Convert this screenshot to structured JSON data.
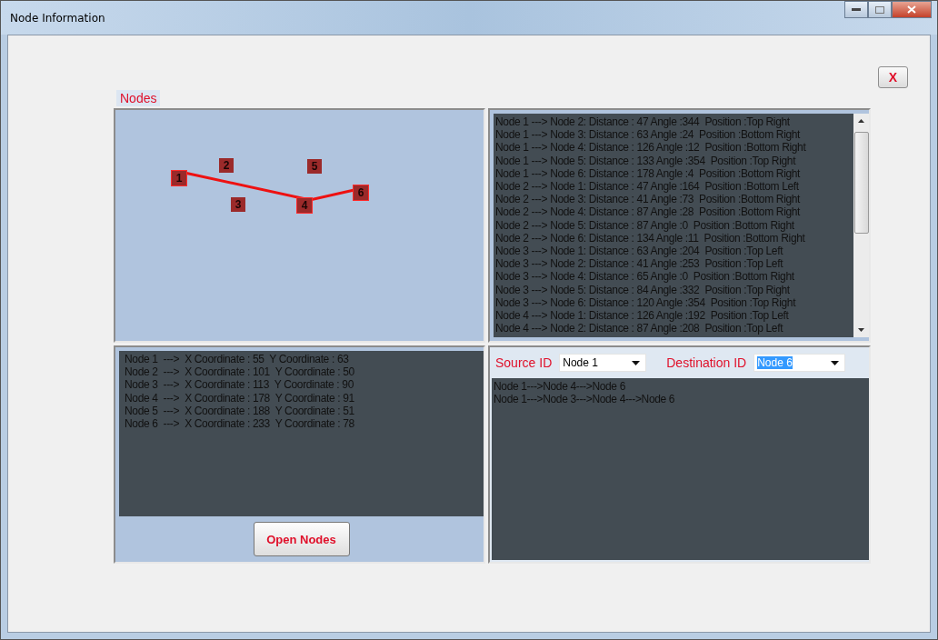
{
  "window": {
    "title": "Node Information"
  },
  "close_form_button": {
    "label": "X"
  },
  "nodes_panel": {
    "label": "Nodes",
    "nodes": [
      {
        "label": "1",
        "on_path": true
      },
      {
        "label": "2",
        "on_path": false
      },
      {
        "label": "3",
        "on_path": false
      },
      {
        "label": "4",
        "on_path": true
      },
      {
        "label": "5",
        "on_path": false
      },
      {
        "label": "6",
        "on_path": true
      }
    ]
  },
  "distance_list": {
    "lines": [
      "Node 1 ---> Node 2: Distance : 47 Angle :344  Position :Top Right",
      "Node 1 ---> Node 3: Distance : 63 Angle :24  Position :Bottom Right",
      "Node 1 ---> Node 4: Distance : 126 Angle :12  Position :Bottom Right",
      "Node 1 ---> Node 5: Distance : 133 Angle :354  Position :Top Right",
      "Node 1 ---> Node 6: Distance : 178 Angle :4  Position :Bottom Right",
      "Node 2 ---> Node 1: Distance : 47 Angle :164  Position :Bottom Left",
      "Node 2 ---> Node 3: Distance : 41 Angle :73  Position :Bottom Right",
      "Node 2 ---> Node 4: Distance : 87 Angle :28  Position :Bottom Right",
      "Node 2 ---> Node 5: Distance : 87 Angle :0  Position :Bottom Right",
      "Node 2 ---> Node 6: Distance : 134 Angle :11  Position :Bottom Right",
      "Node 3 ---> Node 1: Distance : 63 Angle :204  Position :Top Left",
      "Node 3 ---> Node 2: Distance : 41 Angle :253  Position :Top Left",
      "Node 3 ---> Node 4: Distance : 65 Angle :0  Position :Bottom Right",
      "Node 3 ---> Node 5: Distance : 84 Angle :332  Position :Top Right",
      "Node 3 ---> Node 6: Distance : 120 Angle :354  Position :Top Right",
      "Node 4 ---> Node 1: Distance : 126 Angle :192  Position :Top Left",
      "Node 4 ---> Node 2: Distance : 87 Angle :208  Position :Top Left"
    ]
  },
  "coordinate_list": {
    "lines": [
      "Node 1  --->  X Coordinate : 55  Y Coordinate : 63",
      "Node 2  --->  X Coordinate : 101  Y Coordinate : 50",
      "Node 3  --->  X Coordinate : 113  Y Coordinate : 90",
      "Node 4  --->  X Coordinate : 178  Y Coordinate : 91",
      "Node 5  --->  X Coordinate : 188  Y Coordinate : 51",
      "Node 6  --->  X Coordinate : 233  Y Coordinate : 78"
    ]
  },
  "open_nodes_button": {
    "label": "Open Nodes"
  },
  "route_panel": {
    "source_label": "Source ID",
    "source_value": "Node 1",
    "destination_label": "Destination ID",
    "destination_value": "Node 6",
    "destination_selected": true,
    "routes": [
      "Node 1--->Node 4--->Node 6",
      "Node 1--->Node 3--->Node 4--->Node 6"
    ]
  }
}
